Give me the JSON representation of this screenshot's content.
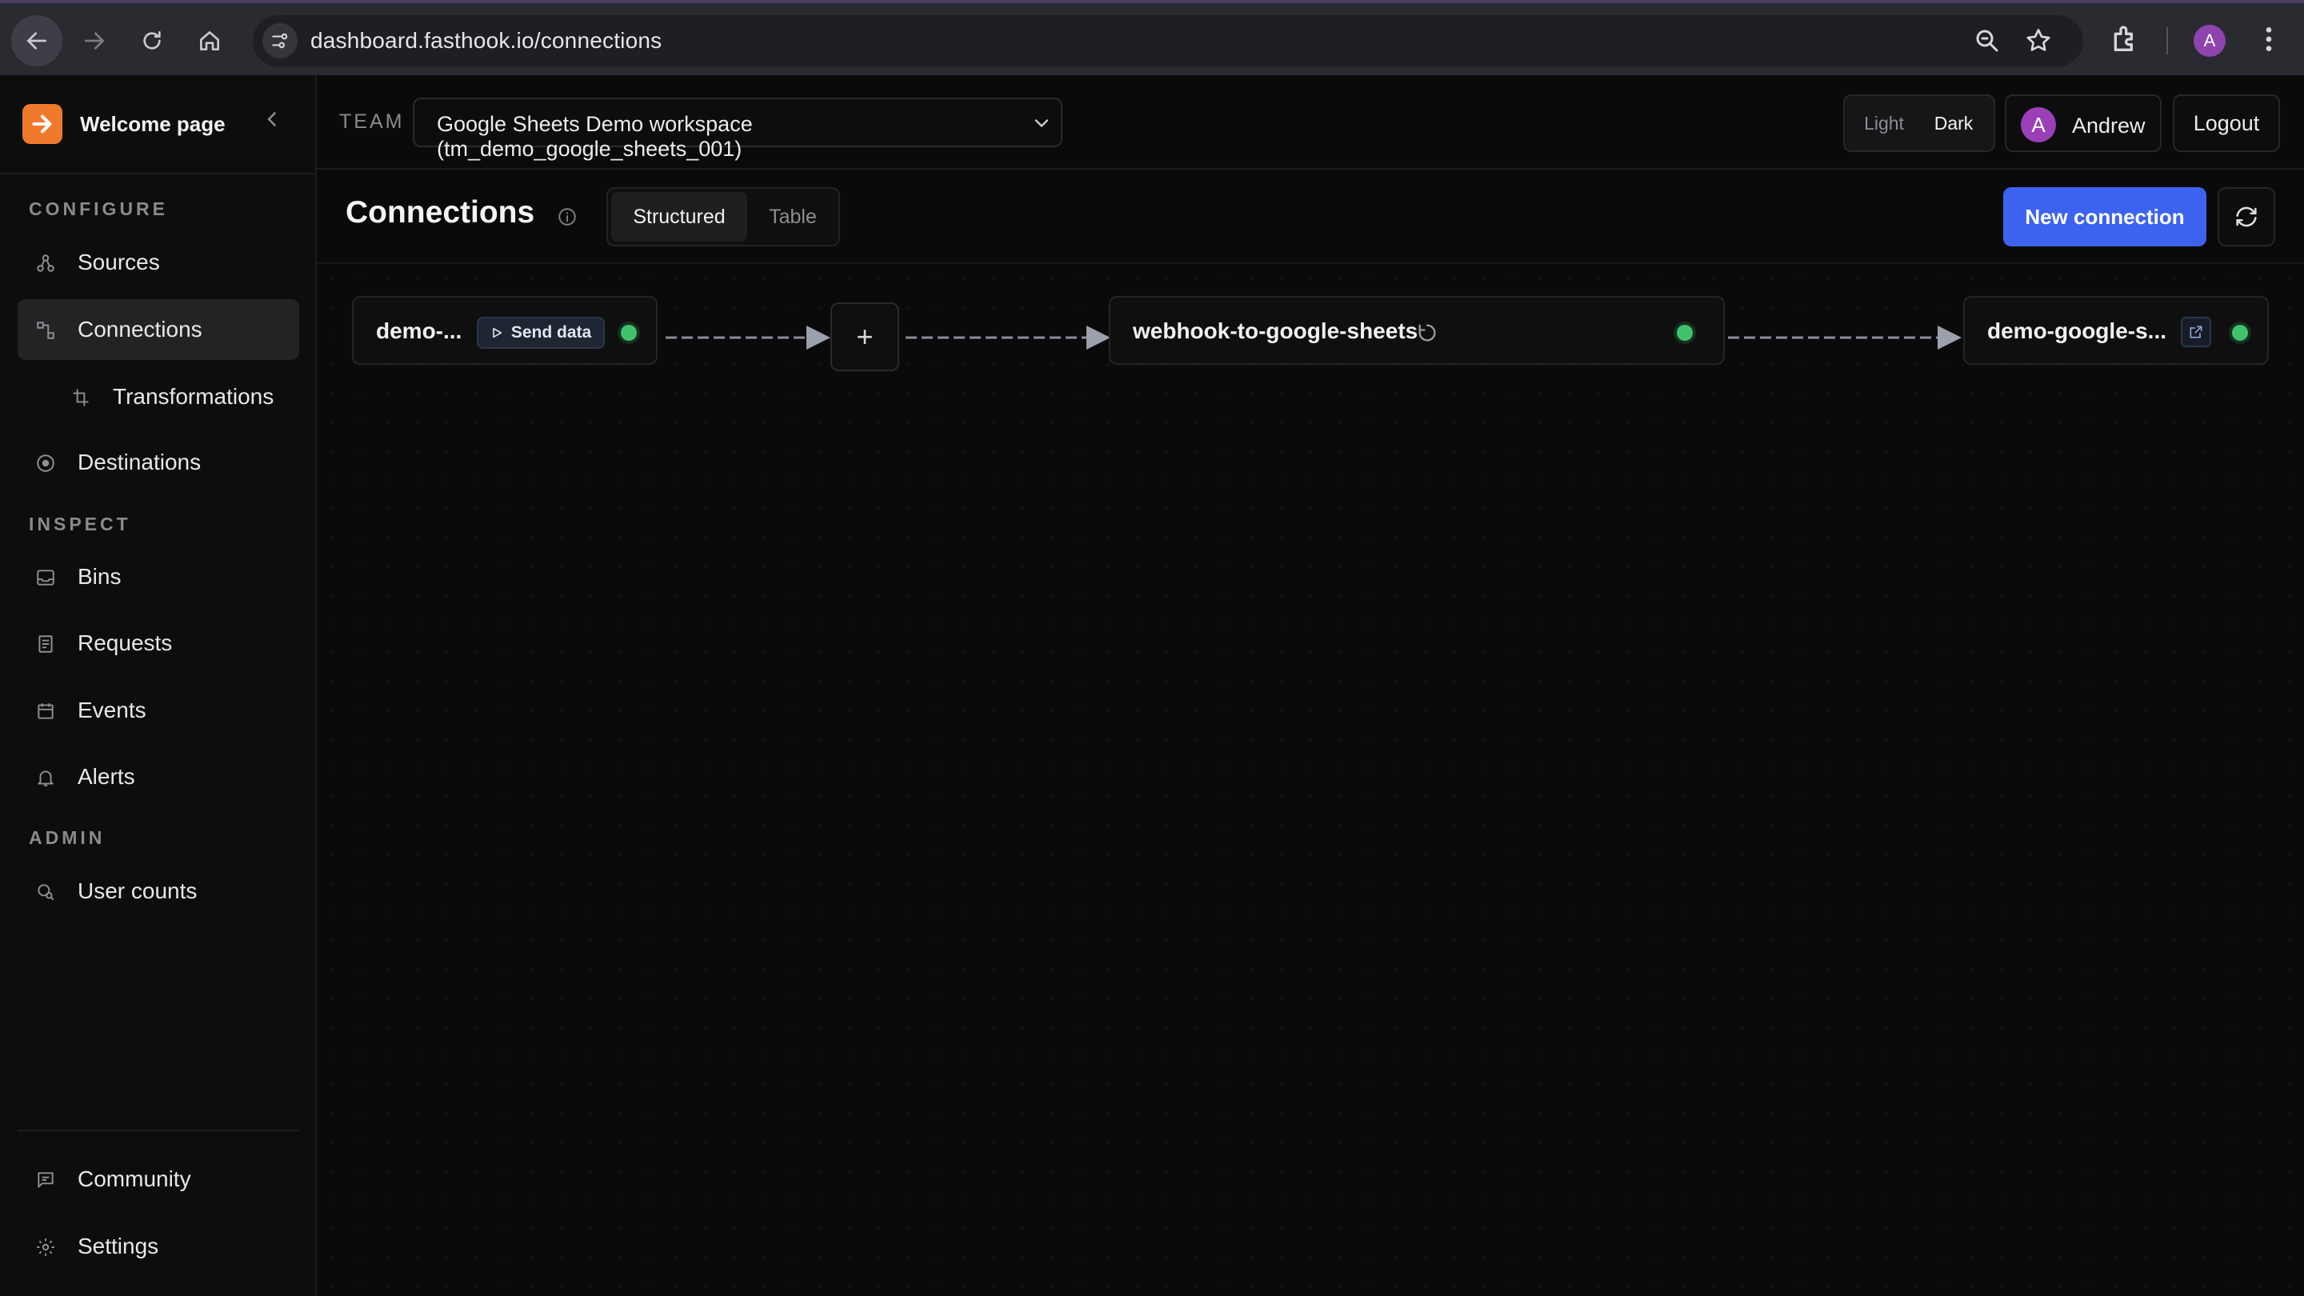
{
  "browser": {
    "url": "dashboard.fasthook.io/connections",
    "profile_initial": "A"
  },
  "sidebar": {
    "brand": "Welcome page",
    "sections": {
      "configure": "CONFIGURE",
      "inspect": "INSPECT",
      "admin": "ADMIN"
    },
    "items": {
      "sources": "Sources",
      "connections": "Connections",
      "transformations": "Transformations",
      "destinations": "Destinations",
      "bins": "Bins",
      "requests": "Requests",
      "events": "Events",
      "alerts": "Alerts",
      "user_counts": "User counts",
      "community": "Community",
      "settings": "Settings"
    }
  },
  "topbar": {
    "team_label": "TEAM",
    "team_value": "Google Sheets Demo workspace (tm_demo_google_sheets_001)",
    "theme_light": "Light",
    "theme_dark": "Dark",
    "user_initial": "A",
    "user_name": "Andrew",
    "logout": "Logout"
  },
  "page": {
    "title": "Connections",
    "tabs": {
      "structured": "Structured",
      "table": "Table"
    },
    "new_connection": "New connection"
  },
  "flow": {
    "source_name": "demo-...",
    "send_data": "Send data",
    "add_symbol": "+",
    "connection_name": "webhook-to-google-sheets",
    "destination_name": "demo-google-s...",
    "status_color": "#3fc46a",
    "accent_color": "#3c63f0"
  }
}
